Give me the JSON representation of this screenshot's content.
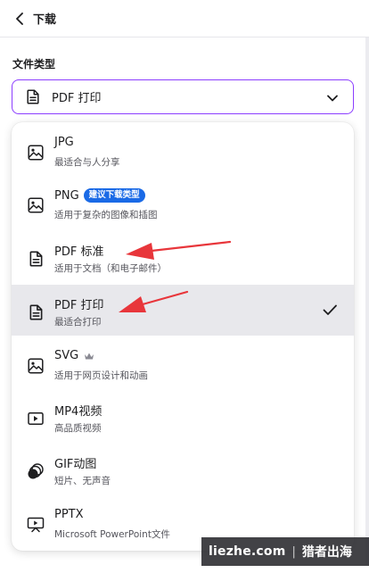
{
  "header": {
    "title": "下载"
  },
  "section": {
    "label": "文件类型"
  },
  "select": {
    "value": "PDF 打印"
  },
  "options": [
    {
      "title": "JPG",
      "desc": "最适合与人分享",
      "icon": "image-icon"
    },
    {
      "title": "PNG",
      "desc": "适用于复杂的图像和插图",
      "badge": "建议下载类型",
      "icon": "image-icon"
    },
    {
      "title": "PDF 标准",
      "desc": "适用于文档（和电子邮件）",
      "icon": "document-icon"
    },
    {
      "title": "PDF 打印",
      "desc": "最适合打印",
      "icon": "document-icon",
      "selected": true
    },
    {
      "title": "SVG",
      "desc": "适用于网页设计和动画",
      "icon": "image-icon",
      "premium": true
    },
    {
      "title": "MP4视频",
      "desc": "高品质视频",
      "icon": "video-icon"
    },
    {
      "title": "GIF动图",
      "desc": "短片、无声音",
      "icon": "gif-icon"
    },
    {
      "title": "PPTX",
      "desc": "Microsoft PowerPoint文件",
      "icon": "presentation-icon"
    }
  ],
  "watermark": {
    "site": "liezhe.com",
    "separator": "|",
    "name": "猎者出海"
  },
  "colors": {
    "accent": "#8b3dff",
    "badge": "#1a6ae6",
    "annotation": "#e8363b",
    "selected_bg": "#e8e8ec"
  }
}
